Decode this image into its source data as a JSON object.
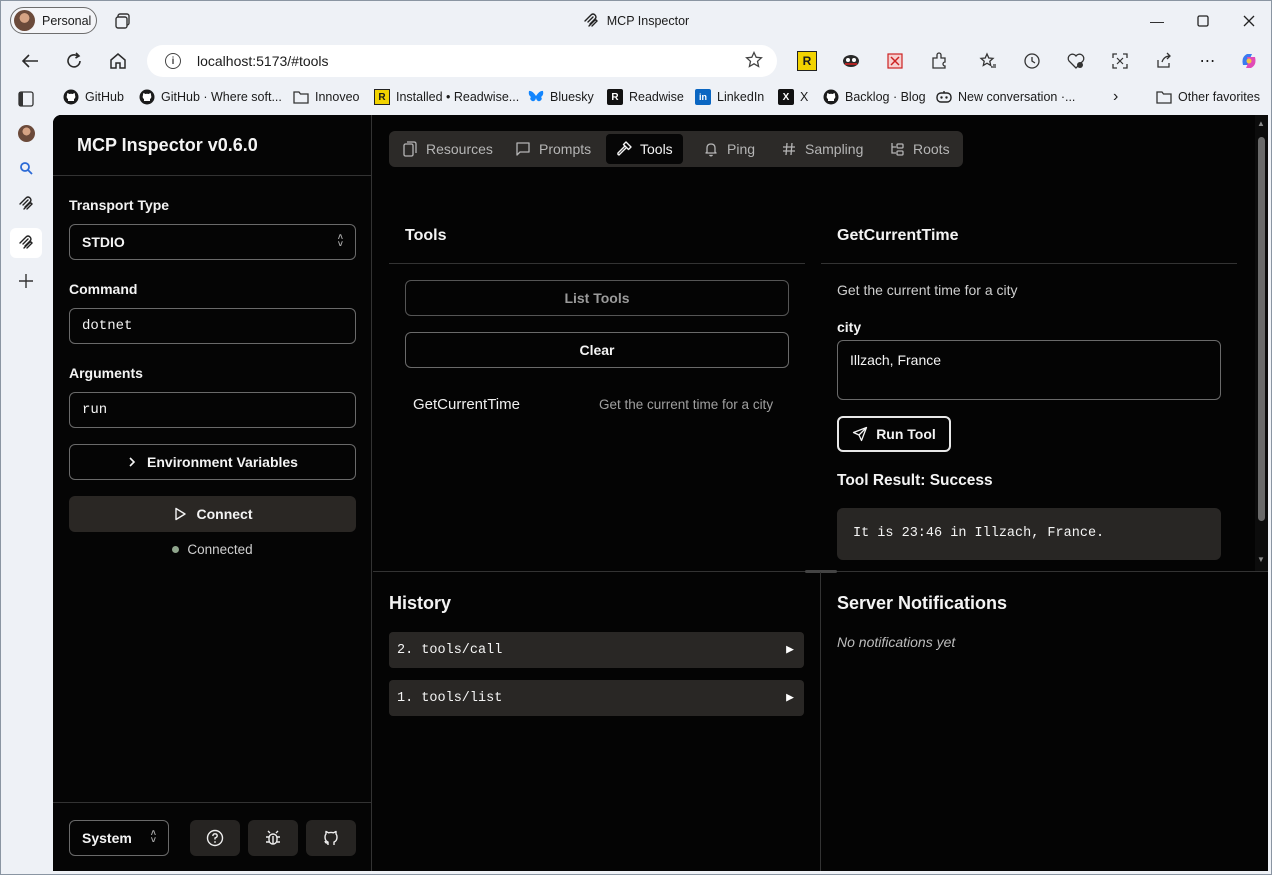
{
  "browser": {
    "profile_label": "Personal",
    "window_title": "MCP Inspector",
    "url": "localhost:5173/#tools",
    "favorites": [
      {
        "label": "GitHub",
        "icon": "github-icon"
      },
      {
        "label": "GitHub · Where soft...",
        "icon": "github-icon"
      },
      {
        "label": "Innoveo",
        "icon": "folder-icon"
      },
      {
        "label": "Installed • Readwise...",
        "icon": "readwise-icon"
      },
      {
        "label": "Bluesky",
        "icon": "bluesky-icon"
      },
      {
        "label": "Readwise",
        "icon": "readwise-icon"
      },
      {
        "label": "LinkedIn",
        "icon": "linkedin-icon"
      },
      {
        "label": "X",
        "icon": "x-icon"
      },
      {
        "label": "Backlog · Blog",
        "icon": "github-icon"
      },
      {
        "label": "New conversation ·...",
        "icon": "chat-icon"
      }
    ],
    "other_favorites": "Other favorites"
  },
  "app": {
    "title": "MCP Inspector v0.6.0",
    "transport": {
      "label": "Transport Type",
      "value": "STDIO"
    },
    "command": {
      "label": "Command",
      "value": "dotnet"
    },
    "arguments": {
      "label": "Arguments",
      "value": "run"
    },
    "env_button": "Environment Variables",
    "connect_button": "Connect",
    "status": {
      "text": "Connected",
      "color": "#8fa58c"
    },
    "theme": "System"
  },
  "tabs": [
    "Resources",
    "Prompts",
    "Tools",
    "Ping",
    "Sampling",
    "Roots"
  ],
  "active_tab": "Tools",
  "tools_panel": {
    "title": "Tools",
    "list_button": "List Tools",
    "clear_button": "Clear",
    "items": [
      {
        "name": "GetCurrentTime",
        "description": "Get the current time for a city"
      }
    ]
  },
  "detail_panel": {
    "title": "GetCurrentTime",
    "description": "Get the current time for a city",
    "param_label": "city",
    "param_value": "Illzach, France",
    "run_button": "Run Tool",
    "result_title": "Tool Result: Success",
    "result_text": "It is 23:46 in Illzach, France."
  },
  "history": {
    "title": "History",
    "items": [
      "2. tools/call",
      "1. tools/list"
    ]
  },
  "notifications": {
    "title": "Server Notifications",
    "empty": "No notifications yet"
  }
}
